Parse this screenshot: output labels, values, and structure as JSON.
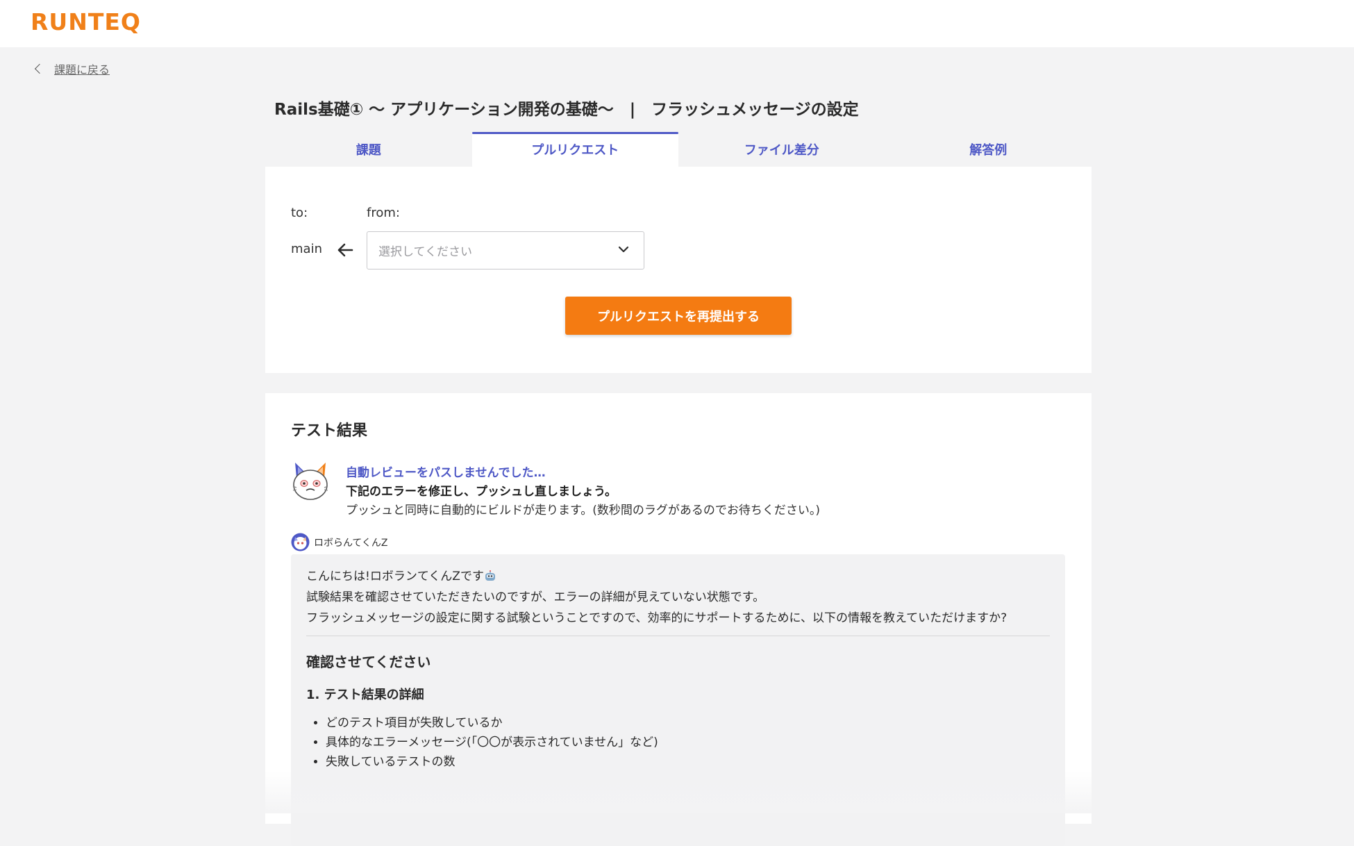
{
  "header": {
    "logo": "RUNTEQ"
  },
  "nav": {
    "back_label": "課題に戻る"
  },
  "page": {
    "title": "Rails基礎① 〜 アプリケーション開発の基礎〜　|　フラッシュメッセージの設定"
  },
  "tabs": [
    {
      "label": "課題",
      "active": false
    },
    {
      "label": "プルリクエスト",
      "active": true
    },
    {
      "label": "ファイル差分",
      "active": false
    },
    {
      "label": "解答例",
      "active": false
    }
  ],
  "pull_request": {
    "to_label": "to:",
    "from_label": "from:",
    "base_branch": "main",
    "select_placeholder": "選択してください",
    "submit_label": "プルリクエストを再提出する"
  },
  "test_result": {
    "title": "テスト結果",
    "status_heading": "自動レビューをパスしませんでした…",
    "status_instruction": "下記のエラーを修正し、プッシュし直しましょう。",
    "status_note": "プッシュと同時に自動的にビルドが走ります。(数秒間のラグがあるのでお待ちください。)",
    "bot_name": "ロボらんてくんZ",
    "message": {
      "greeting": "こんにちは!ロボランてくんZです",
      "line1": "試験結果を確認させていただきたいのですが、エラーの詳細が見えていない状態です。",
      "line2": "フラッシュメッセージの設定に関する試験ということですので、効率的にサポートするために、以下の情報を教えていただけますか?",
      "section_heading": "確認させてください",
      "subheading": "1. テスト結果の詳細",
      "items": [
        "どのテスト項目が失敗しているか",
        "具体的なエラーメッセージ(「〇〇が表示されていません」など)",
        "失敗しているテストの数"
      ]
    }
  },
  "colors": {
    "brand_orange": "#f08019",
    "button_orange": "#f47b12",
    "accent_blue": "#4e58c6",
    "page_bg": "#f3f3f4"
  },
  "icons": {
    "back": "chevron-left-icon",
    "direction": "arrow-left-icon",
    "dropdown": "chevron-down-icon",
    "mascot": "robot-cat-icon",
    "bot_avatar": "bot-avatar-icon",
    "robot_emoji": "robot-emoji-icon"
  }
}
